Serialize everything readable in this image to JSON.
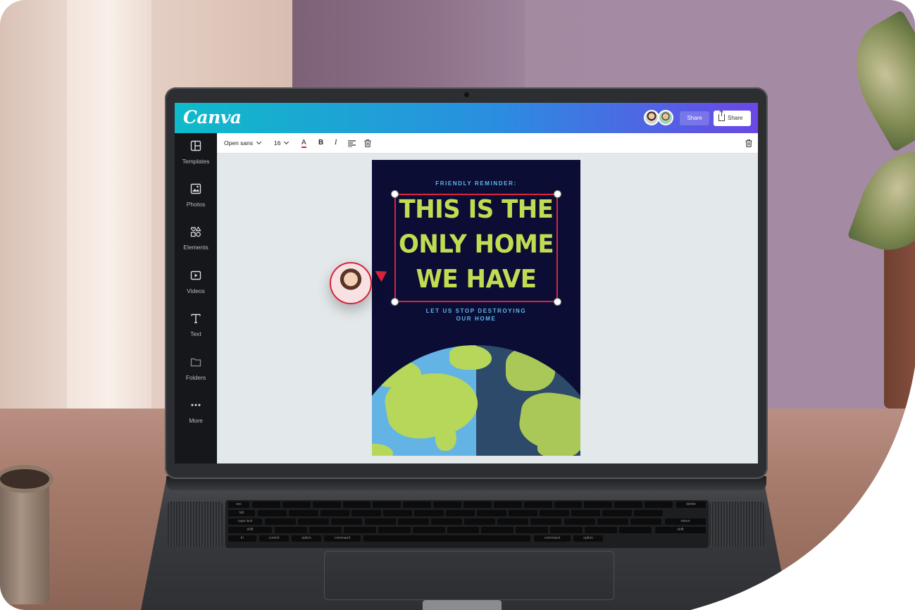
{
  "app": {
    "logo": "Canva"
  },
  "header": {
    "share_label": "Share",
    "share_button_label": "Share",
    "avatars": [
      "user-avatar-1",
      "user-avatar-2"
    ]
  },
  "sidebar": {
    "items": [
      {
        "label": "Templates",
        "icon": "templates-icon"
      },
      {
        "label": "Photos",
        "icon": "photos-icon"
      },
      {
        "label": "Elements",
        "icon": "elements-icon"
      },
      {
        "label": "Videos",
        "icon": "videos-icon"
      },
      {
        "label": "Text",
        "icon": "text-icon"
      },
      {
        "label": "Folders",
        "icon": "folders-icon"
      },
      {
        "label": "More",
        "icon": "more-icon"
      }
    ]
  },
  "toolbar": {
    "font_family": "Open sans",
    "font_size": "16",
    "color_letter": "A",
    "bold": "B",
    "italic": "I"
  },
  "poster": {
    "reminder": "FRIENDLY REMINDER:",
    "headline_line1": "THIS IS THE",
    "headline_line2": "ONLY HOME",
    "headline_line3": "WE HAVE",
    "footer_line1": "LET US STOP DESTROYING",
    "footer_line2": "OUR HOME",
    "colors": {
      "background": "#0b0d35",
      "headline": "#c2dc52",
      "subtext": "#5fb7e8",
      "selection": "#e0233a"
    }
  },
  "keyboard": {
    "labels": [
      "esc",
      "delete",
      "tab",
      "caps lock",
      "return",
      "shift",
      "shift",
      "fn",
      "control",
      "option",
      "command",
      "command",
      "option"
    ]
  }
}
